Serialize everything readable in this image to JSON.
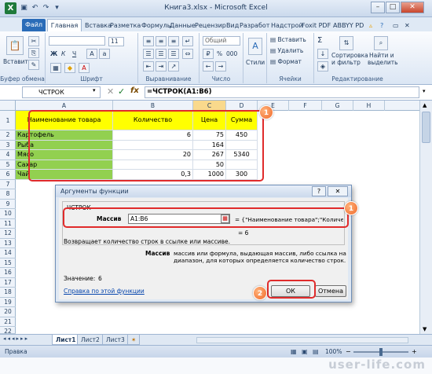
{
  "window": {
    "title": "Книга3.xlsx - Microsoft Excel",
    "app_icon": "X",
    "controls": {
      "minimize": "–",
      "maximize": "□",
      "close": "✕"
    }
  },
  "ribbon_tabs": [
    "Файл",
    "Главная",
    "Вставка",
    "Разметка",
    "Формулы",
    "Данные",
    "Рецензир",
    "Вид",
    "Разработ",
    "Надстрой",
    "Foxit PDF",
    "ABBYY PD"
  ],
  "ribbon": {
    "clipboard": {
      "paste": "Вставить",
      "label": "Буфер обмена"
    },
    "font": {
      "font_size": "11",
      "bold": "Ж",
      "italic": "К",
      "underline": "Ч",
      "label": "Шрифт"
    },
    "alignment": {
      "label": "Выравнивание"
    },
    "number": {
      "format": "Общий",
      "percent": "%",
      "thousands": "000",
      "label": "Число"
    },
    "styles": {
      "label": "Стили"
    },
    "cells": {
      "insert": "Вставить",
      "delete": "Удалить",
      "format": "Формат",
      "label": "Ячейки"
    },
    "editing": {
      "sigma": "Σ",
      "sort": "Сортировка",
      "sort2": "и фильтр",
      "find": "Найти и",
      "find2": "выделить",
      "label": "Редактирование"
    }
  },
  "formula_bar": {
    "name_box": "ЧСТРОК",
    "formula": "=ЧСТРОК(A1:B6)",
    "fx": "fx"
  },
  "columns": [
    "A",
    "B",
    "C",
    "D",
    "E",
    "F",
    "G",
    "H"
  ],
  "rows": [
    "1",
    "2",
    "3",
    "4",
    "5",
    "6",
    "7",
    "8",
    "9",
    "10",
    "11",
    "12",
    "13",
    "14",
    "15",
    "16",
    "17",
    "18",
    "19",
    "20",
    "21",
    "22"
  ],
  "table": {
    "headers": [
      "Наименование товара",
      "Количество",
      "Цена",
      "Сумма"
    ],
    "rows": [
      [
        "Картофель",
        "6",
        "75",
        "450"
      ],
      [
        "Рыба",
        "",
        "164",
        ""
      ],
      [
        "Мясо",
        "20",
        "267",
        "5340"
      ],
      [
        "Сахар",
        "",
        "50",
        ""
      ],
      [
        "Чай",
        "0,3",
        "1000",
        "300"
      ]
    ]
  },
  "dialog": {
    "title": "Аргументы функции",
    "help": "?",
    "close": "✕",
    "function_name": "ЧСТРОК",
    "arg_label": "Массив",
    "arg_value": "A1:B6",
    "arg_result": "= {\"Наименование товара\";\"Количес...",
    "result_eq": "= 6",
    "description": "Возвращает количество строк в ссылке или массиве.",
    "arg_desc_label": "Массив",
    "arg_desc": "массив или формула, выдающая массив, либо ссылка на диапазон, для которых определяется количество строк.",
    "value_label": "Значение:",
    "value": "6",
    "help_link": "Справка по этой функции",
    "ok": "ОК",
    "cancel": "Отмена"
  },
  "badges": {
    "one": "1",
    "one_b": "1",
    "two": "2"
  },
  "sheet_tabs": [
    "Лист1",
    "Лист2",
    "Лист3"
  ],
  "status": {
    "mode": "Правка",
    "zoom": "100%"
  },
  "watermark": "user-life.com",
  "colors": {
    "yellow": "#ffff00",
    "green": "#92d050",
    "red_highlight": "#e02b2b",
    "badge_orange": "#f0692a"
  }
}
